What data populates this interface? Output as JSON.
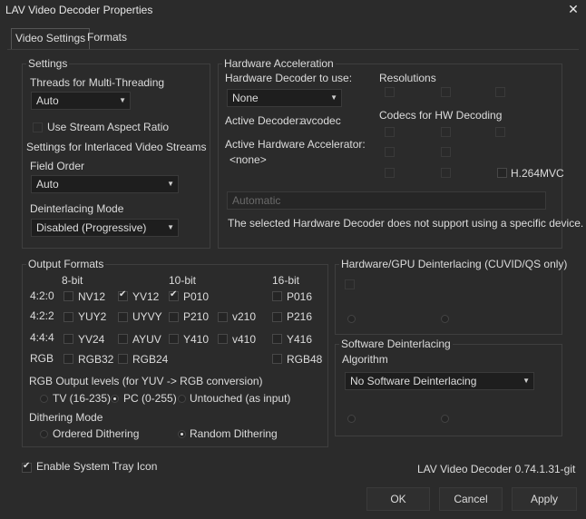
{
  "window": {
    "title": "LAV Video Decoder Properties"
  },
  "tabs": [
    {
      "label": "Video Settings"
    },
    {
      "label": "Formats"
    }
  ],
  "settings": {
    "title": "Settings",
    "threads_label": "Threads for Multi-Threading",
    "threads_value": "Auto",
    "stream_aspect_label": "Use Stream Aspect Ratio",
    "interlaced_title": "Settings for Interlaced Video Streams",
    "field_order_label": "Field Order",
    "field_order_value": "Auto",
    "deint_mode_label": "Deinterlacing Mode",
    "deint_mode_value": "Disabled (Progressive)"
  },
  "hwaccel": {
    "title": "Hardware Acceleration",
    "decoder_label": "Hardware Decoder to use:",
    "decoder_value": "None",
    "active_decoder_label": "Active Decoder:",
    "active_decoder_value": "avcodec",
    "active_accel_label": "Active Hardware Accelerator:",
    "active_accel_value": "<none>",
    "resolutions_label": "Resolutions",
    "codecs_label": "Codecs for HW Decoding",
    "h264mvc_label": "H.264MVC",
    "device_value": "Automatic",
    "device_note": "The selected Hardware Decoder does not support using a specific device."
  },
  "output": {
    "title": "Output Formats",
    "col_8bit": "8-bit",
    "col_10bit": "10-bit",
    "col_16bit": "16-bit",
    "rows": {
      "r420": "4:2:0",
      "r422": "4:2:2",
      "r444": "4:4:4",
      "rgb": "RGB"
    },
    "fmt": {
      "nv12": "NV12",
      "yv12": "YV12",
      "p010": "P010",
      "p016": "P016",
      "yuy2": "YUY2",
      "uyvy": "UYVY",
      "p210": "P210",
      "v210": "v210",
      "p216": "P216",
      "yv24": "YV24",
      "ayuv": "AYUV",
      "y410": "Y410",
      "v410": "v410",
      "y416": "Y416",
      "rgb32": "RGB32",
      "rgb24": "RGB24",
      "rgb48": "RGB48"
    },
    "levels_label": "RGB Output levels (for YUV -> RGB conversion)",
    "tv": "TV (16-235)",
    "pc": "PC (0-255)",
    "untouched": "Untouched (as input)",
    "dither_label": "Dithering Mode",
    "ordered": "Ordered Dithering",
    "random": "Random Dithering"
  },
  "hw_deint": {
    "title": "Hardware/GPU Deinterlacing (CUVID/QS only)"
  },
  "sw_deint": {
    "title": "Software Deinterlacing",
    "algorithm_label": "Algorithm",
    "algorithm_value": "No Software Deinterlacing"
  },
  "footer": {
    "tray_label": "Enable System Tray Icon",
    "version": "LAV Video Decoder 0.74.1.31-git",
    "ok": "OK",
    "cancel": "Cancel",
    "apply": "Apply"
  }
}
